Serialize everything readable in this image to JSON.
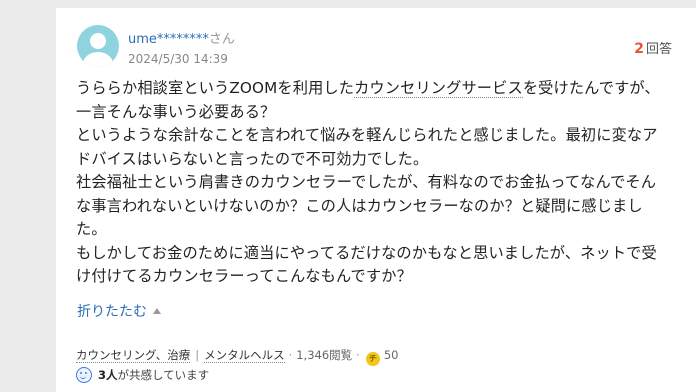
{
  "post": {
    "username": "ume********",
    "honorific": "さん",
    "date": "2024/5/30 14:39",
    "answer_count": "2",
    "answer_label": "回答",
    "body_lines": [
      [
        "うららか相談室というZOOMを利用した",
        "カウンセリングサービス",
        "を受けたんですが、"
      ],
      [
        "一言そんな事いう必要ある？"
      ],
      [
        "というような余計なことを言われて悩みを軽んじられたと感じました。最初に変なア"
      ],
      [
        "ドバイスはいらないと言ったので不可効力でした。"
      ],
      [
        "社会福祉士という肩書きのカウンセラーでしたが、有料なのでお金払ってなんでそん"
      ],
      [
        "な事言われないといけないのか？この人はカウンセラーなのか？と疑問に感じまし"
      ],
      [
        "た。"
      ],
      [
        "もしかしてお金のために適当にやってるだけなのかもなと思いましたが、ネットで受"
      ],
      [
        "け付けてるカウンセラーってこんなもんですか？"
      ]
    ],
    "collapse_label": "折りたたむ"
  },
  "meta": {
    "category": "カウンセリング、治療",
    "category2": "メンタルヘルス",
    "views": "1,346閲覧",
    "coin_symbol": "チ",
    "coins": "50"
  },
  "empathy": {
    "count": "3人",
    "text": "が共感しています"
  },
  "icons": {
    "avatar": "default-user-avatar-icon",
    "collapse": "caret-up-icon",
    "coin": "chiebukuro-coin-icon",
    "empathy": "smile-face-icon"
  },
  "colors": {
    "link": "#2a6ebb",
    "answer_count": "#e8513b",
    "avatar_bg": "#8fd3df",
    "coin": "#f5c518"
  }
}
